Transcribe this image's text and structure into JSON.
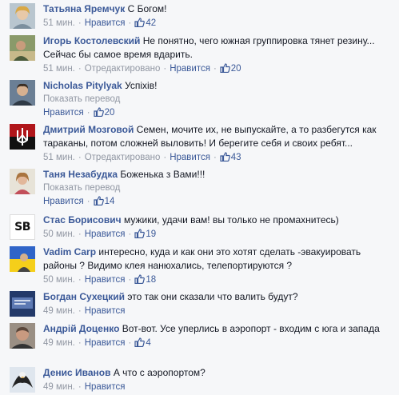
{
  "comments": [
    {
      "name": "Татьяна Яремчук",
      "text": "С Богом!",
      "time": "51 мин.",
      "action": "Нравится",
      "likes": "42",
      "edited": "",
      "translate": ""
    },
    {
      "name": "Игорь Костолевский",
      "text": "Не понятно, чего южная группировка тянет резину... Сейчас бы самое время вдарить.",
      "time": "51 мин.",
      "action": "Нравится",
      "likes": "20",
      "edited": "Отредактировано",
      "translate": ""
    },
    {
      "name": "Nicholas Pitylyak",
      "text": "Успіхів!",
      "time": "",
      "action": "Нравится",
      "likes": "20",
      "edited": "",
      "translate": "Показать перевод"
    },
    {
      "name": "Дмитрий Мозговой",
      "text": "Семен, мочите их, не выпускайте, а то разбегутся как тараканы, потом сложней выловить! И берегите себя и своих ребят...",
      "time": "51 мин.",
      "action": "Нравится",
      "likes": "43",
      "edited": "Отредактировано",
      "translate": ""
    },
    {
      "name": "Таня Незабудка",
      "text": "Боженька з Вами!!!",
      "time": "",
      "action": "Нравится",
      "likes": "14",
      "edited": "",
      "translate": "Показать перевод"
    },
    {
      "name": "Стас Борисович",
      "text": "мужики, удачи вам! вы только не промахнитесь)",
      "time": "50 мин.",
      "action": "Нравится",
      "likes": "19",
      "edited": "",
      "translate": ""
    },
    {
      "name": "Vadim Carp",
      "text": "интересно, куда и как они это хотят сделать -эвакуировать районы ? Видимо клея нанюхались, телепортируются ?",
      "time": "50 мин.",
      "action": "Нравится",
      "likes": "18",
      "edited": "",
      "translate": ""
    },
    {
      "name": "Богдан Сухецкий",
      "text": "это так они сказали что валить будут?",
      "time": "49 мин.",
      "action": "Нравится",
      "likes": "",
      "edited": "",
      "translate": ""
    },
    {
      "name": "Андрій Доценко",
      "text": "Вот-вот. Усе уперлись в аэропорт - входим с юга и запада",
      "time": "49 мин.",
      "action": "Нравится",
      "likes": "4",
      "edited": "",
      "translate": ""
    },
    {
      "name": "Денис Иванов",
      "text": "А что с аэропортом?",
      "time": "49 мин.",
      "action": "Нравится",
      "likes": "",
      "edited": "",
      "translate": ""
    }
  ],
  "avatar_badges": {
    "sb": "SB"
  },
  "colors": {
    "link": "#3b5998",
    "meta": "#9197a3",
    "bg": "#f6f7f9"
  },
  "icons": {
    "like": "thumbs-up-icon"
  }
}
